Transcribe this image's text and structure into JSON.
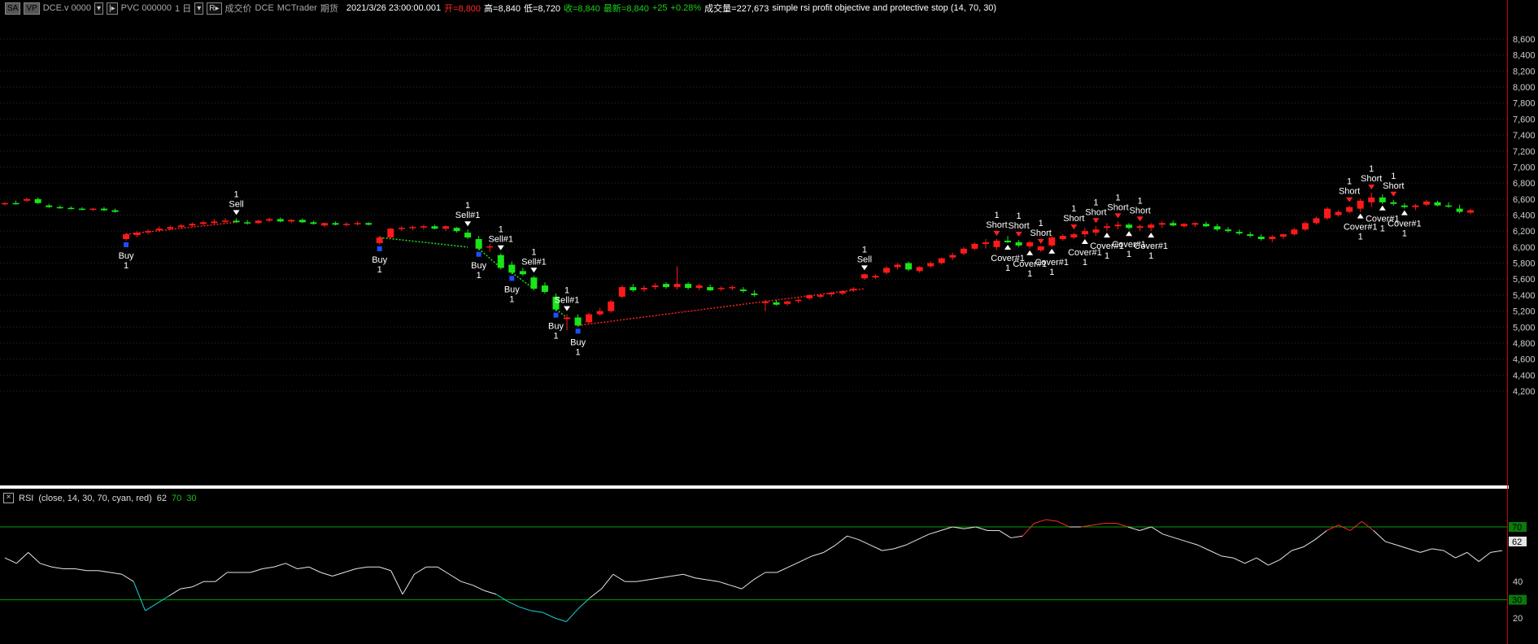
{
  "header": {
    "sym_box": "SA",
    "vp_box": "VP",
    "contract": "DCE.v 0000",
    "indicator_box": "PVC 000000",
    "period": "1 日",
    "price_type": "成交价",
    "exchange": "DCE",
    "provider": "MCTrader",
    "category": "期货",
    "datetime": "2021/3/26  23:00:00.001",
    "open_label": "开=8,800",
    "high_label": "高=8,840",
    "low_label": "低=8,720",
    "close_label": "收=8,840",
    "last_label": "最新=8,840",
    "change": "+25",
    "change_pct": "+0.28%",
    "volume_label": "成交量=227,673",
    "strategy": "simple rsi profit objective and protective stop (14,  70,  30)"
  },
  "colors": {
    "up": "#ff1a1a",
    "down": "#19e619",
    "rsi": "#e6e6e6",
    "rsi_low": "#19d4d4",
    "rsi_high": "#ff2a2a",
    "guide": "#00a000",
    "trade_win": "#ff2020",
    "trade_loss": "#20e020",
    "grid": "#2a2a2a",
    "border_right": "#c00000"
  },
  "price_axis": {
    "min": 4200,
    "max": 8600,
    "step": 200,
    "labels": [
      "8,600",
      "8,400",
      "8,200",
      "8,000",
      "7,800",
      "7,600",
      "7,400",
      "7,200",
      "7,000",
      "6,800",
      "6,600",
      "6,400",
      "6,200",
      "6,000",
      "5,800",
      "5,600",
      "5,400",
      "5,200",
      "5,000",
      "4,800",
      "4,600",
      "4,400",
      "4,200"
    ]
  },
  "rsi_panel": {
    "legend_name": "RSI",
    "legend_params": "(close,  14,  30,  70,  cyan,  red)",
    "current_value": "62",
    "overbought": "70",
    "oversold": "30",
    "axis_labels": [
      "40",
      "20"
    ],
    "values": [
      53,
      50,
      56,
      50,
      48,
      47,
      47,
      46,
      46,
      45,
      44,
      40,
      24,
      28,
      32,
      36,
      37,
      40,
      40,
      45,
      45,
      45,
      47,
      48,
      50,
      47,
      48,
      45,
      43,
      45,
      47,
      48,
      48,
      46,
      33,
      44,
      48,
      48,
      44,
      40,
      38,
      35,
      33,
      29,
      26,
      24,
      23,
      20,
      18,
      25,
      31,
      36,
      44,
      40,
      40,
      41,
      42,
      43,
      44,
      42,
      41,
      40,
      38,
      36,
      41,
      45,
      45,
      48,
      51,
      54,
      56,
      60,
      65,
      63,
      60,
      57,
      58,
      60,
      63,
      66,
      68,
      70,
      69,
      70,
      68,
      68,
      64,
      65,
      72,
      74,
      73,
      70,
      70,
      71,
      72,
      72,
      70,
      68,
      70,
      66,
      64,
      62,
      60,
      57,
      54,
      53,
      50,
      53,
      49,
      52,
      57,
      59,
      63,
      68,
      71,
      68,
      73,
      68,
      62,
      60,
      58,
      56,
      58,
      57,
      53,
      56,
      51,
      56,
      57
    ]
  },
  "candles": [
    [
      6540,
      6560,
      6520,
      6550
    ],
    [
      6550,
      6580,
      6530,
      6540
    ],
    [
      6580,
      6620,
      6560,
      6600
    ],
    [
      6600,
      6620,
      6540,
      6550
    ],
    [
      6520,
      6540,
      6490,
      6500
    ],
    [
      6500,
      6520,
      6480,
      6490
    ],
    [
      6490,
      6510,
      6470,
      6480
    ],
    [
      6480,
      6500,
      6460,
      6470
    ],
    [
      6470,
      6490,
      6450,
      6480
    ],
    [
      6480,
      6500,
      6450,
      6460
    ],
    [
      6460,
      6480,
      6430,
      6440
    ],
    [
      6100,
      6180,
      6080,
      6160
    ],
    [
      6150,
      6200,
      6120,
      6180
    ],
    [
      6190,
      6220,
      6160,
      6200
    ],
    [
      6210,
      6260,
      6190,
      6230
    ],
    [
      6230,
      6270,
      6210,
      6250
    ],
    [
      6250,
      6290,
      6230,
      6270
    ],
    [
      6270,
      6310,
      6250,
      6290
    ],
    [
      6290,
      6330,
      6270,
      6310
    ],
    [
      6300,
      6350,
      6280,
      6320
    ],
    [
      6320,
      6360,
      6300,
      6330
    ],
    [
      6330,
      6360,
      6300,
      6310
    ],
    [
      6310,
      6340,
      6280,
      6300
    ],
    [
      6300,
      6340,
      6290,
      6330
    ],
    [
      6330,
      6370,
      6310,
      6350
    ],
    [
      6350,
      6370,
      6310,
      6320
    ],
    [
      6320,
      6350,
      6300,
      6340
    ],
    [
      6340,
      6360,
      6300,
      6310
    ],
    [
      6310,
      6330,
      6280,
      6290
    ],
    [
      6270,
      6310,
      6250,
      6300
    ],
    [
      6300,
      6320,
      6270,
      6280
    ],
    [
      6280,
      6310,
      6260,
      6290
    ],
    [
      6290,
      6320,
      6270,
      6300
    ],
    [
      6300,
      6310,
      6270,
      6280
    ],
    [
      6050,
      6140,
      6030,
      6120
    ],
    [
      6120,
      6240,
      6100,
      6230
    ],
    [
      6230,
      6260,
      6200,
      6240
    ],
    [
      6240,
      6270,
      6210,
      6250
    ],
    [
      6250,
      6280,
      6220,
      6260
    ],
    [
      6260,
      6280,
      6220,
      6230
    ],
    [
      6230,
      6270,
      6200,
      6260
    ],
    [
      6240,
      6250,
      6180,
      6200
    ],
    [
      6180,
      6220,
      6100,
      6120
    ],
    [
      6100,
      6140,
      5960,
      5980
    ],
    [
      6000,
      6040,
      5940,
      6010
    ],
    [
      5900,
      5920,
      5720,
      5740
    ],
    [
      5780,
      5820,
      5660,
      5680
    ],
    [
      5700,
      5740,
      5640,
      5660
    ],
    [
      5620,
      5640,
      5460,
      5480
    ],
    [
      5520,
      5560,
      5420,
      5440
    ],
    [
      5380,
      5420,
      5200,
      5220
    ],
    [
      5100,
      5160,
      4960,
      5120
    ],
    [
      5120,
      5160,
      5000,
      5020
    ],
    [
      5060,
      5180,
      5040,
      5160
    ],
    [
      5160,
      5240,
      5140,
      5200
    ],
    [
      5200,
      5340,
      5180,
      5320
    ],
    [
      5380,
      5520,
      5360,
      5500
    ],
    [
      5500,
      5540,
      5440,
      5460
    ],
    [
      5470,
      5520,
      5440,
      5490
    ],
    [
      5500,
      5550,
      5470,
      5520
    ],
    [
      5540,
      5560,
      5480,
      5500
    ],
    [
      5500,
      5760,
      5470,
      5540
    ],
    [
      5540,
      5560,
      5470,
      5490
    ],
    [
      5490,
      5540,
      5460,
      5520
    ],
    [
      5500,
      5530,
      5450,
      5460
    ],
    [
      5480,
      5510,
      5450,
      5490
    ],
    [
      5490,
      5520,
      5460,
      5500
    ],
    [
      5470,
      5500,
      5430,
      5450
    ],
    [
      5420,
      5460,
      5380,
      5400
    ],
    [
      5300,
      5340,
      5200,
      5320
    ],
    [
      5310,
      5340,
      5270,
      5280
    ],
    [
      5290,
      5330,
      5270,
      5320
    ],
    [
      5330,
      5360,
      5300,
      5340
    ],
    [
      5360,
      5410,
      5340,
      5400
    ],
    [
      5380,
      5420,
      5360,
      5400
    ],
    [
      5410,
      5440,
      5380,
      5430
    ],
    [
      5420,
      5460,
      5400,
      5450
    ],
    [
      5460,
      5500,
      5440,
      5480
    ],
    [
      5610,
      5670,
      5590,
      5660
    ],
    [
      5620,
      5660,
      5600,
      5640
    ],
    [
      5680,
      5760,
      5660,
      5740
    ],
    [
      5750,
      5800,
      5720,
      5780
    ],
    [
      5800,
      5820,
      5700,
      5720
    ],
    [
      5700,
      5760,
      5680,
      5750
    ],
    [
      5760,
      5820,
      5740,
      5800
    ],
    [
      5800,
      5870,
      5780,
      5860
    ],
    [
      5870,
      5930,
      5840,
      5900
    ],
    [
      5920,
      6000,
      5900,
      5980
    ],
    [
      5980,
      6060,
      5960,
      6040
    ],
    [
      6040,
      6100,
      5980,
      6060
    ],
    [
      6000,
      6100,
      5960,
      6080
    ],
    [
      6080,
      6140,
      6050,
      6060
    ],
    [
      6060,
      6090,
      6000,
      6020
    ],
    [
      6010,
      6080,
      5980,
      6060
    ],
    [
      5960,
      6000,
      5940,
      6010
    ],
    [
      6020,
      6140,
      6000,
      6120
    ],
    [
      6100,
      6160,
      6080,
      6140
    ],
    [
      6120,
      6180,
      6100,
      6160
    ],
    [
      6160,
      6240,
      6120,
      6200
    ],
    [
      6180,
      6260,
      6140,
      6220
    ],
    [
      6240,
      6300,
      6200,
      6260
    ],
    [
      6260,
      6320,
      6220,
      6280
    ],
    [
      6280,
      6300,
      6220,
      6240
    ],
    [
      6240,
      6280,
      6200,
      6260
    ],
    [
      6240,
      6300,
      6200,
      6280
    ],
    [
      6280,
      6320,
      6240,
      6300
    ],
    [
      6300,
      6330,
      6260,
      6270
    ],
    [
      6260,
      6300,
      6240,
      6290
    ],
    [
      6280,
      6310,
      6250,
      6300
    ],
    [
      6290,
      6320,
      6250,
      6260
    ],
    [
      6260,
      6290,
      6200,
      6220
    ],
    [
      6220,
      6250,
      6180,
      6200
    ],
    [
      6190,
      6220,
      6150,
      6170
    ],
    [
      6160,
      6190,
      6120,
      6140
    ],
    [
      6130,
      6160,
      6080,
      6100
    ],
    [
      6100,
      6150,
      6060,
      6130
    ],
    [
      6130,
      6170,
      6100,
      6160
    ],
    [
      6160,
      6240,
      6140,
      6220
    ],
    [
      6220,
      6320,
      6200,
      6300
    ],
    [
      6300,
      6380,
      6280,
      6360
    ],
    [
      6360,
      6500,
      6340,
      6480
    ],
    [
      6400,
      6460,
      6380,
      6440
    ],
    [
      6440,
      6520,
      6420,
      6500
    ],
    [
      6480,
      6600,
      6440,
      6580
    ],
    [
      6560,
      6680,
      6500,
      6620
    ],
    [
      6620,
      6660,
      6540,
      6560
    ],
    [
      6560,
      6590,
      6520,
      6540
    ],
    [
      6520,
      6550,
      6480,
      6500
    ],
    [
      6500,
      6540,
      6460,
      6520
    ],
    [
      6530,
      6590,
      6510,
      6570
    ],
    [
      6560,
      6580,
      6510,
      6520
    ],
    [
      6520,
      6560,
      6490,
      6510
    ],
    [
      6480,
      6530,
      6420,
      6440
    ],
    [
      6430,
      6480,
      6410,
      6460
    ]
  ],
  "signals": [
    {
      "text": "Buy",
      "qty": "1",
      "i": 11,
      "kind": "buy"
    },
    {
      "text": "Sell",
      "qty": "1",
      "i": 21,
      "kind": "sell"
    },
    {
      "text": "Buy",
      "qty": "1",
      "i": 34,
      "kind": "buy"
    },
    {
      "text": "Sell#1",
      "qty": "1",
      "i": 42,
      "kind": "sell"
    },
    {
      "text": "Buy",
      "qty": "1",
      "i": 43,
      "kind": "buy"
    },
    {
      "text": "Sell#1",
      "qty": "1",
      "i": 45,
      "kind": "sell"
    },
    {
      "text": "Buy",
      "qty": "1",
      "i": 46,
      "kind": "buy"
    },
    {
      "text": "Sell#1",
      "qty": "1",
      "i": 48,
      "kind": "sell"
    },
    {
      "text": "Buy",
      "qty": "1",
      "i": 50,
      "kind": "buy"
    },
    {
      "text": "Sell#1",
      "qty": "1",
      "i": 51,
      "kind": "sell"
    },
    {
      "text": "Buy",
      "qty": "1",
      "i": 52,
      "kind": "buy"
    },
    {
      "text": "Sell",
      "qty": "1",
      "i": 78,
      "kind": "sell"
    },
    {
      "text": "Short",
      "qty": "1",
      "i": 90,
      "kind": "short"
    },
    {
      "text": "Cover#1",
      "qty": "1",
      "i": 91,
      "kind": "cover"
    },
    {
      "text": "Short",
      "qty": "1",
      "i": 92,
      "kind": "short"
    },
    {
      "text": "Cover#1",
      "qty": "1",
      "i": 93,
      "kind": "cover"
    },
    {
      "text": "Short",
      "qty": "1",
      "i": 94,
      "kind": "short"
    },
    {
      "text": "Cover#1",
      "qty": "1",
      "i": 95,
      "kind": "cover"
    },
    {
      "text": "Short",
      "qty": "1",
      "i": 97,
      "kind": "short"
    },
    {
      "text": "Cover#1",
      "qty": "1",
      "i": 98,
      "kind": "cover"
    },
    {
      "text": "Short",
      "qty": "1",
      "i": 99,
      "kind": "short"
    },
    {
      "text": "Cover#1",
      "qty": "1",
      "i": 100,
      "kind": "cover"
    },
    {
      "text": "Short",
      "qty": "1",
      "i": 101,
      "kind": "short"
    },
    {
      "text": "Cover#1",
      "qty": "1",
      "i": 102,
      "kind": "cover"
    },
    {
      "text": "Short",
      "qty": "1",
      "i": 103,
      "kind": "short"
    },
    {
      "text": "Cover#1",
      "qty": "1",
      "i": 104,
      "kind": "cover"
    },
    {
      "text": "Short",
      "qty": "1",
      "i": 122,
      "kind": "short"
    },
    {
      "text": "Cover#1",
      "qty": "1",
      "i": 123,
      "kind": "cover"
    },
    {
      "text": "Short",
      "qty": "1",
      "i": 124,
      "kind": "short"
    },
    {
      "text": "Cover#1",
      "qty": "1",
      "i": 125,
      "kind": "cover"
    },
    {
      "text": "Short",
      "qty": "1",
      "i": 126,
      "kind": "short"
    },
    {
      "text": "Cover#1",
      "qty": "1",
      "i": 127,
      "kind": "cover"
    }
  ],
  "trades": [
    {
      "from": 11,
      "fromPrice": 6160,
      "to": 21,
      "toPrice": 6310,
      "result": "win"
    },
    {
      "from": 34,
      "fromPrice": 6120,
      "to": 42,
      "toPrice": 6000,
      "result": "loss"
    },
    {
      "from": 43,
      "fromPrice": 5980,
      "to": 45,
      "toPrice": 5740,
      "result": "loss"
    },
    {
      "from": 46,
      "fromPrice": 5680,
      "to": 48,
      "toPrice": 5480,
      "result": "loss"
    },
    {
      "from": 50,
      "fromPrice": 5220,
      "to": 51,
      "toPrice": 5120,
      "result": "loss"
    },
    {
      "from": 52,
      "fromPrice": 5020,
      "to": 78,
      "toPrice": 5480,
      "result": "win"
    }
  ]
}
